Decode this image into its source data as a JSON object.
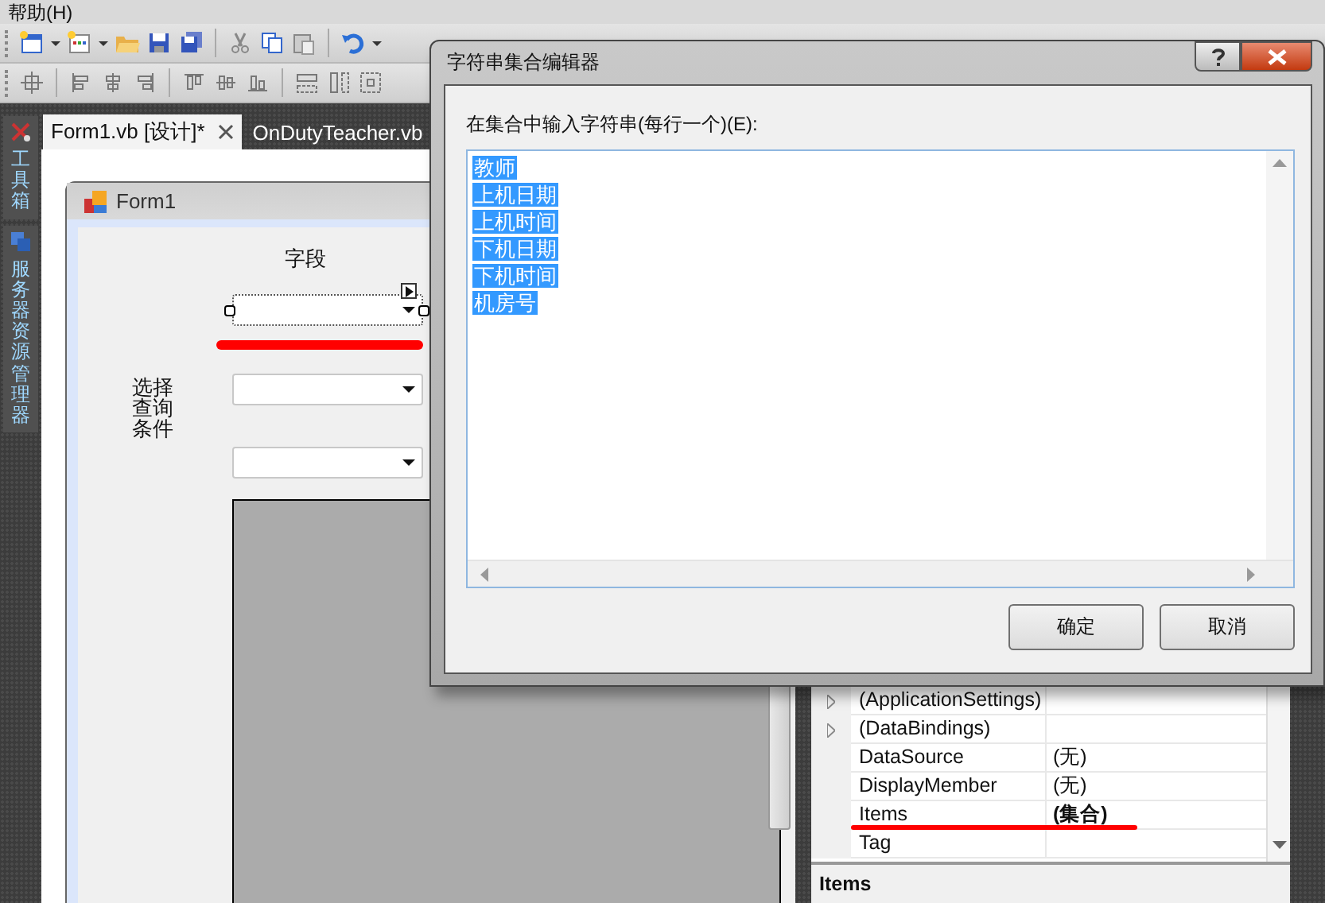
{
  "menu_bar": {
    "items": [
      "帮助(H)"
    ]
  },
  "side_strip": {
    "items": [
      {
        "label": "工具箱"
      },
      {
        "label": "服务器资源管理器"
      }
    ]
  },
  "tabs": [
    {
      "label": "Form1.vb [设计]*",
      "selected": true,
      "closable": true
    },
    {
      "label": "OnDutyTeacher.vb",
      "selected": false,
      "closable": false
    }
  ],
  "form": {
    "title": "Form1",
    "field_label": "字段",
    "condition_label": "选择查询条件",
    "combos": [
      {
        "selected": true
      },
      {
        "selected": false
      },
      {
        "selected": false
      }
    ]
  },
  "properties": {
    "rows": [
      {
        "name": "(ApplicationSettings)",
        "expandable": true
      },
      {
        "name": "(DataBindings)",
        "expandable": true
      },
      {
        "name": "DataSource",
        "value": "(无)",
        "expandable": false,
        "modified": false
      },
      {
        "name": "DisplayMember",
        "value": "(无)",
        "expandable": false,
        "modified": false
      },
      {
        "name": "Items",
        "value": "(集合)",
        "expandable": false,
        "modified": true
      },
      {
        "name": "Tag",
        "expandable": false
      }
    ],
    "description": "Items"
  },
  "dialog": {
    "title": "字符串集合编辑器",
    "prompt": "在集合中输入字符串(每行一个)(E):",
    "selected": true,
    "lines": [
      "教师",
      "上机日期",
      "上机时间",
      "下机日期",
      "下机时间",
      "机房号"
    ],
    "buttons": [
      "确定",
      "取消"
    ]
  }
}
